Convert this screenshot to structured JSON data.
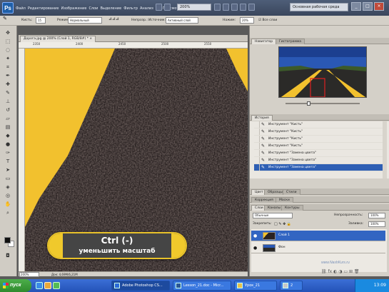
{
  "app": {
    "logo_text": "Ps",
    "menu": [
      "Файл",
      "Редактирование",
      "Изображение",
      "Слои",
      "Выделение",
      "Фильтр",
      "Анализ",
      "3D",
      "Просмотр",
      "Окно",
      "Справка"
    ],
    "zoom": "200%",
    "workspace": "Основная рабочая среда"
  },
  "options_bar": {
    "brush_label": "Кисть:",
    "brush_size": "15",
    "mode_label": "Режим:",
    "mode_value": "Нормальный",
    "opacity_label": "Непрозр.:",
    "opacity_value": "100%",
    "sampling_label": "Источник:",
    "sampling_value": "Активный слой",
    "flow_label": "Нажим:",
    "flow_value": "20%",
    "checkbox_label": "Все слои"
  },
  "document": {
    "tab_title": "Дорога.jpg @ 200% (Слой 1, RGB/8#) *",
    "status_zoom": "200%",
    "status_doc": "Док: 4,69M/6,21M",
    "ruler_marks": [
      "2350",
      "2400",
      "2450",
      "2500",
      "2550"
    ]
  },
  "overlay": {
    "line1": "Ctrl (-)",
    "line2": "уменьшить масштаб"
  },
  "panels": {
    "navigator_tabs": [
      "Навигатор",
      "Гистограмма"
    ],
    "history_tabs": [
      "История"
    ],
    "history_items": [
      "Инструмент \"Кисть\"",
      "Инструмент \"Кисть\"",
      "Инструмент \"Кисть\"",
      "Инструмент \"Кисть\"",
      "Инструмент \"Замена цвета\"",
      "Инструмент \"Замена цвета\"",
      "Инструмент \"Замена цвета\""
    ],
    "adjust_tabs": [
      "Цвет",
      "Образцы",
      "Стили"
    ],
    "adj_tabs2": [
      "Коррекция",
      "Маски"
    ],
    "layers_tabs": [
      "Слои",
      "Каналы",
      "Контуры"
    ],
    "blend_mode": "Обычные",
    "opacity_label": "Непрозрачность:",
    "opacity_value": "100%",
    "lock_label": "Закрепить:",
    "fill_label": "Заливка:",
    "fill_value": "100%",
    "layers": [
      {
        "name": "Слой 1",
        "selected": true
      },
      {
        "name": "Фон",
        "selected": false
      }
    ],
    "watermark": "www.NashKurs.ru"
  },
  "taskbar": {
    "start_label": "пуск",
    "tasks": [
      "Adobe Photoshop CS...",
      "Lesson_21.doc - Micr...",
      "Урок_21",
      "2"
    ],
    "clock": "13:09"
  }
}
